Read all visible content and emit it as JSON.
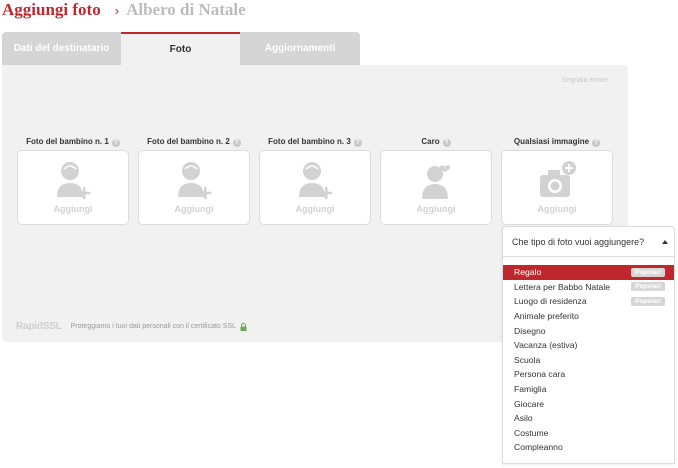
{
  "header": {
    "title": "Aggiungi foto",
    "separator": "›",
    "subtitle": "Albero di Natale"
  },
  "tabs": [
    {
      "label": "Dati del destinatario",
      "active": false
    },
    {
      "label": "Foto",
      "active": true
    },
    {
      "label": "Aggiornamenti",
      "active": false
    }
  ],
  "panel": {
    "report_link": "Segnala errore"
  },
  "slots": [
    {
      "label": "Foto del bambino n. 1",
      "add_label": "Aggiungi",
      "icon": "child-add-icon"
    },
    {
      "label": "Foto del bambino n. 2",
      "add_label": "Aggiungi",
      "icon": "child-add-icon"
    },
    {
      "label": "Foto del bambino n. 3",
      "add_label": "Aggiungi",
      "icon": "child-add-icon"
    },
    {
      "label": "Caro",
      "add_label": "Aggiungi",
      "icon": "person-heart-icon"
    },
    {
      "label": "Qualsiasi immagine",
      "add_label": "Aggiungi",
      "icon": "camera-add-icon"
    }
  ],
  "footer": {
    "ssl_logo": "RapidSSL",
    "ssl_text": "Proteggiamo i tuoi dati personali con il certificato SSL"
  },
  "dropdown": {
    "prompt": "Che tipo di foto vuoi aggiungere?",
    "options": [
      {
        "label": "Regalo",
        "badge": "Popolari",
        "selected": true
      },
      {
        "label": "Lettera per Babbo Natale",
        "badge": "Popolari"
      },
      {
        "label": "Luogo di residenza",
        "badge": "Popolari"
      },
      {
        "label": "Animale preferito"
      },
      {
        "label": "Disegno"
      },
      {
        "label": "Vacanza (estiva)"
      },
      {
        "label": "Scuola"
      },
      {
        "label": "Persona cara"
      },
      {
        "label": "Famiglia"
      },
      {
        "label": "Giocare"
      },
      {
        "label": "Asilo"
      },
      {
        "label": "Costume"
      },
      {
        "label": "Compleanno"
      }
    ]
  },
  "colors": {
    "accent": "#c0272d",
    "panel": "#f1f1f1",
    "tab_inactive": "#d5d5d5",
    "placeholder": "#d2d2d2"
  }
}
